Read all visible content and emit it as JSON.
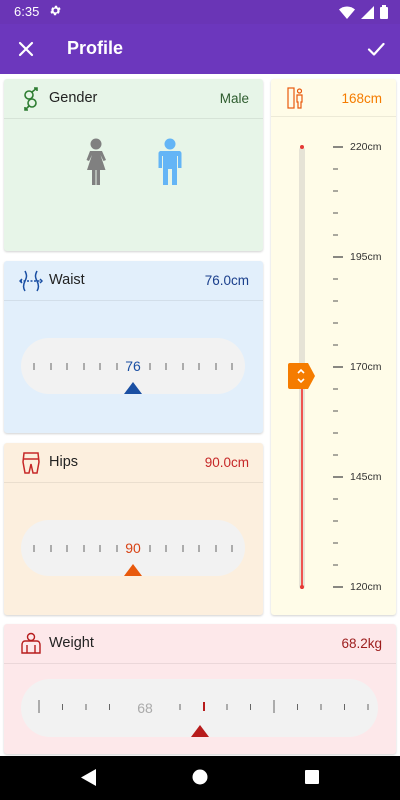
{
  "status_bar": {
    "time": "6:35"
  },
  "app_bar": {
    "title": "Profile"
  },
  "gender": {
    "label": "Gender",
    "value": "Male"
  },
  "waist": {
    "label": "Waist",
    "value": "76.0cm",
    "ruler_number": "76"
  },
  "hips": {
    "label": "Hips",
    "value": "90.0cm",
    "ruler_number": "90"
  },
  "height": {
    "value": "168cm",
    "scale_labels": [
      "220cm",
      "195cm",
      "170cm",
      "145cm",
      "120cm"
    ]
  },
  "weight": {
    "label": "Weight",
    "value": "68.2kg",
    "ruler_number": "68"
  },
  "colors": {
    "purple": "#6c37bd",
    "male_blue": "#64b5f6",
    "female_gray": "#808080",
    "waist_blue": "#1a4fa3",
    "hips_orange": "#e8590c",
    "height_orange": "#f57c00",
    "weight_red": "#b71c1c"
  }
}
